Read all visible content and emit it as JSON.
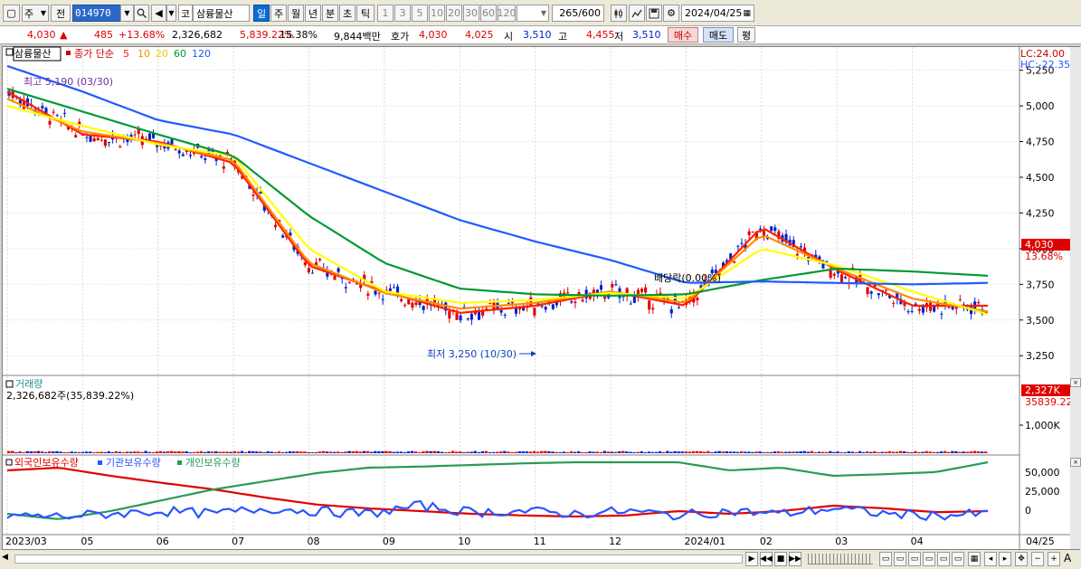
{
  "toolbar": {
    "type_label": "주",
    "market_label": "전",
    "stock_code": "014970",
    "kor_label": "코",
    "stock_name": "삼륭물산",
    "periods": [
      "일",
      "주",
      "월",
      "년",
      "분",
      "초",
      "틱"
    ],
    "period_selected": "일",
    "intervals": [
      "1",
      "3",
      "5",
      "10",
      "20",
      "30",
      "60",
      "120"
    ],
    "count_display": "265",
    "count_total": "/600",
    "date": "2024/04/25"
  },
  "infobar": {
    "price": "4,030",
    "change": "485",
    "change_pct": "+13.68%",
    "volume": "2,326,682",
    "volume_pct": "5,839.22%",
    "turnover": "15.38%",
    "amount": "9,844백만",
    "quote_label": "호가",
    "quote_ask": "4,030",
    "quote_bid": "4,025",
    "open_label": "시",
    "open": "3,510",
    "high_label": "고",
    "high": "4,455",
    "low_label": "저",
    "low": "3,510",
    "buy_label": "매수",
    "sell_label": "매도",
    "avg_label": "평"
  },
  "colors": {
    "up": "#e00000",
    "down": "#0020d0",
    "ma5": "#ff1f00",
    "ma10": "#ff8c00",
    "ma20": "#ffff00",
    "ma60": "#009933",
    "ma120": "#1f5bff"
  },
  "price_panel": {
    "legend_name": "삼륭물산",
    "legend_series": "종가 단순",
    "ma_labels": [
      "5",
      "10",
      "20",
      "60",
      "120"
    ],
    "lc_label": "LC:24.00",
    "hc_label": "HC:-22.35",
    "high_annot": "최고 5,190 (03/30)",
    "low_annot": "최저 3,250 (10/30)",
    "dividend_annot": "배당락(0.00%)",
    "ticks": [
      "5,250",
      "5,000",
      "4,750",
      "4,500",
      "4,250",
      "4,000",
      "3,750",
      "3,500",
      "3,250"
    ],
    "current_price_tag": "4,030",
    "current_pct_tag": "13.68%"
  },
  "volume_panel": {
    "title": "거래량",
    "value_text": "2,326,682주(35,839.22%)",
    "ticks": [
      "1,000K"
    ],
    "tag_value": "2,327K",
    "tag_pct": "35839.22%"
  },
  "holdings_panel": {
    "legend": [
      "외국인보유수량",
      "기관보유수량",
      "개인보유수량"
    ],
    "ticks": [
      "50,000",
      "25,000",
      "0"
    ]
  },
  "x_axis": {
    "labels": [
      "2023/03",
      "05",
      "06",
      "07",
      "08",
      "09",
      "10",
      "11",
      "12",
      "2024/01",
      "02",
      "03",
      "04",
      "04/25"
    ]
  },
  "chart_data": {
    "type": "line",
    "title": "",
    "x": [
      "2023/03",
      "05",
      "06",
      "07",
      "08",
      "09",
      "10",
      "11",
      "12",
      "2024/01",
      "02",
      "03",
      "04",
      "04/25"
    ],
    "series": [
      {
        "name": "5",
        "values": [
          5100,
          4800,
          4750,
          4600,
          3880,
          3700,
          3550,
          3600,
          3700,
          3600,
          4150,
          3850,
          3600,
          3600
        ]
      },
      {
        "name": "10",
        "values": [
          5050,
          4820,
          4740,
          4620,
          3900,
          3690,
          3580,
          3620,
          3700,
          3620,
          4100,
          3860,
          3650,
          3560
        ]
      },
      {
        "name": "20",
        "values": [
          5000,
          4860,
          4730,
          4650,
          4000,
          3700,
          3620,
          3640,
          3690,
          3650,
          4000,
          3880,
          3700,
          3540
        ]
      },
      {
        "name": "60",
        "values": [
          5120,
          4960,
          4800,
          4650,
          4230,
          3900,
          3720,
          3680,
          3670,
          3680,
          3780,
          3860,
          3840,
          3810
        ]
      },
      {
        "name": "120",
        "values": [
          5280,
          5100,
          4900,
          4800,
          4600,
          4400,
          4200,
          4050,
          3920,
          3760,
          3770,
          3760,
          3750,
          3760
        ]
      }
    ],
    "ylim": [
      3150,
      5330
    ],
    "grid": true,
    "legend": "top-left"
  }
}
